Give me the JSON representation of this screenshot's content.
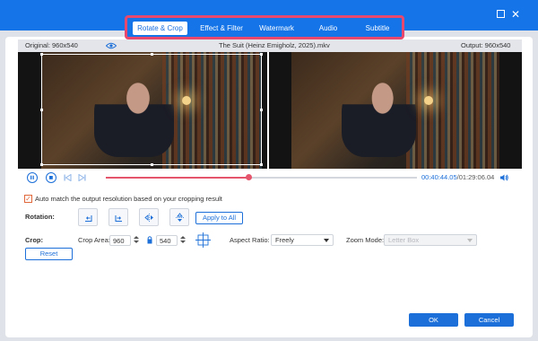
{
  "window": {
    "maximize_icon": "maximize-icon",
    "close_icon": "close-icon"
  },
  "tabs": [
    {
      "label": "Rotate & Crop",
      "active": true
    },
    {
      "label": "Effect & Filter",
      "active": false
    },
    {
      "label": "Watermark",
      "active": false
    },
    {
      "label": "Audio",
      "active": false
    },
    {
      "label": "Subtitle",
      "active": false
    }
  ],
  "info": {
    "original": "Original: 960x540",
    "filename": "The Suit (Heinz Emigholz, 2025).mkv",
    "output": "Output: 960x540"
  },
  "player": {
    "current_time": "00:40:44.05",
    "total_time": "/01:29:06.04",
    "progress": 0.457
  },
  "auto_match": {
    "label": "Auto match the output resolution based on your cropping result",
    "checked": true
  },
  "rotation": {
    "label": "Rotation:",
    "apply_all": "Apply to All"
  },
  "crop": {
    "label": "Crop:",
    "area_label": "Crop Area:",
    "width": "960",
    "height": "540",
    "reset": "Reset"
  },
  "aspect_ratio": {
    "label": "Aspect Ratio:",
    "value": "Freely"
  },
  "zoom_mode": {
    "label": "Zoom Mode:",
    "value": "Letter Box"
  },
  "footer": {
    "ok": "OK",
    "cancel": "Cancel"
  },
  "colors": {
    "accent": "#1c6fd8",
    "titlebar": "#1474e8",
    "highlight": "#e8486e",
    "progress": "#e5556c"
  }
}
